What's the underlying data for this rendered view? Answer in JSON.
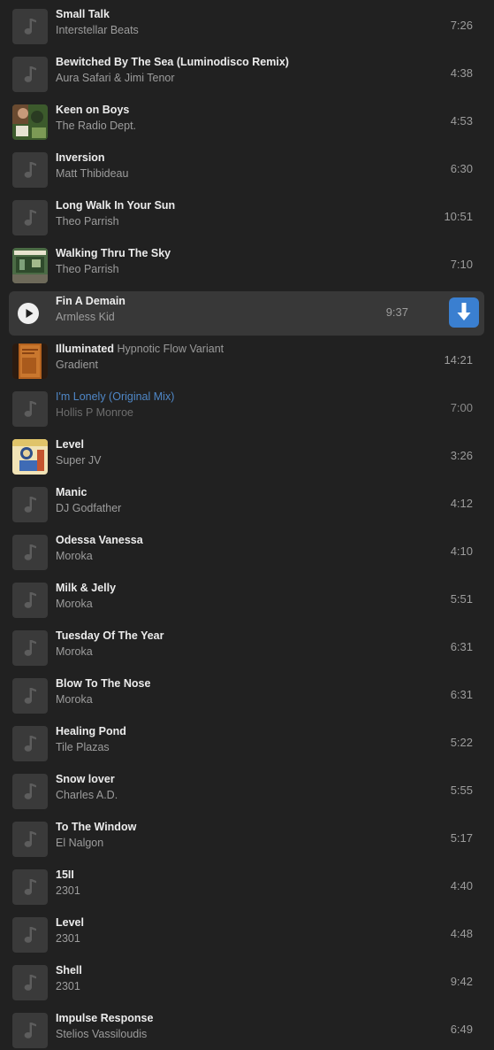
{
  "icons": {
    "placeholder": "music-note-icon",
    "play": "play-icon",
    "download": "download-arrow-icon"
  },
  "colors": {
    "background": "#212121",
    "active_row": "#383838",
    "accent_blue": "#3a7fd0",
    "link_blue": "#4f87c7"
  },
  "tracks": [
    {
      "title": "Small Talk",
      "variant": "",
      "artist": "Interstellar Beats",
      "duration": "7:26",
      "art": "note",
      "state": ""
    },
    {
      "title": "Bewitched By The Sea (Luminodisco Remix)",
      "variant": "",
      "artist": "Aura Safari & Jimi Tenor",
      "duration": "4:38",
      "art": "note",
      "state": ""
    },
    {
      "title": "Keen on Boys",
      "variant": "",
      "artist": "The Radio Dept.",
      "duration": "4:53",
      "art": "cover-keen",
      "state": ""
    },
    {
      "title": "Inversion",
      "variant": "",
      "artist": "Matt Thibideau",
      "duration": "6:30",
      "art": "note",
      "state": ""
    },
    {
      "title": "Long Walk In Your Sun",
      "variant": "",
      "artist": "Theo Parrish",
      "duration": "10:51",
      "art": "note",
      "state": ""
    },
    {
      "title": "Walking Thru The Sky",
      "variant": "",
      "artist": "Theo Parrish",
      "duration": "7:10",
      "art": "cover-walking",
      "state": ""
    },
    {
      "title": "Fin A Demain",
      "variant": "",
      "artist": "Armless Kid",
      "duration": "9:37",
      "art": "play",
      "state": "active"
    },
    {
      "title": "Illuminated",
      "variant": "Hypnotic Flow Variant",
      "artist": "Gradient",
      "duration": "14:21",
      "art": "cover-illuminated",
      "state": ""
    },
    {
      "title": "I'm Lonely (Original Mix)",
      "variant": "",
      "artist": "Hollis P Monroe",
      "duration": "7:00",
      "art": "note",
      "state": "dim"
    },
    {
      "title": "Level",
      "variant": "",
      "artist": "Super JV",
      "duration": "3:26",
      "art": "cover-level",
      "state": ""
    },
    {
      "title": "Manic",
      "variant": "",
      "artist": "DJ Godfather",
      "duration": "4:12",
      "art": "note",
      "state": ""
    },
    {
      "title": "Odessa Vanessa",
      "variant": "",
      "artist": "Moroka",
      "duration": "4:10",
      "art": "note",
      "state": ""
    },
    {
      "title": "Milk & Jelly",
      "variant": "",
      "artist": "Moroka",
      "duration": "5:51",
      "art": "note",
      "state": ""
    },
    {
      "title": "Tuesday Of The Year",
      "variant": "",
      "artist": "Moroka",
      "duration": "6:31",
      "art": "note",
      "state": ""
    },
    {
      "title": "Blow To The Nose",
      "variant": "",
      "artist": "Moroka",
      "duration": "6:31",
      "art": "note",
      "state": ""
    },
    {
      "title": "Healing Pond",
      "variant": "",
      "artist": "Tile Plazas",
      "duration": "5:22",
      "art": "note",
      "state": ""
    },
    {
      "title": "Snow lover",
      "variant": "",
      "artist": "Charles A.D.",
      "duration": "5:55",
      "art": "note",
      "state": ""
    },
    {
      "title": "To The Window",
      "variant": "",
      "artist": "El Nalgon",
      "duration": "5:17",
      "art": "note",
      "state": ""
    },
    {
      "title": "15II",
      "variant": "",
      "artist": "2301",
      "duration": "4:40",
      "art": "note",
      "state": ""
    },
    {
      "title": "Level",
      "variant": "",
      "artist": "2301",
      "duration": "4:48",
      "art": "note",
      "state": ""
    },
    {
      "title": "Shell",
      "variant": "",
      "artist": "2301",
      "duration": "9:42",
      "art": "note",
      "state": ""
    },
    {
      "title": "Impulse Response",
      "variant": "",
      "artist": "Stelios Vassiloudis",
      "duration": "6:49",
      "art": "note",
      "state": ""
    }
  ]
}
